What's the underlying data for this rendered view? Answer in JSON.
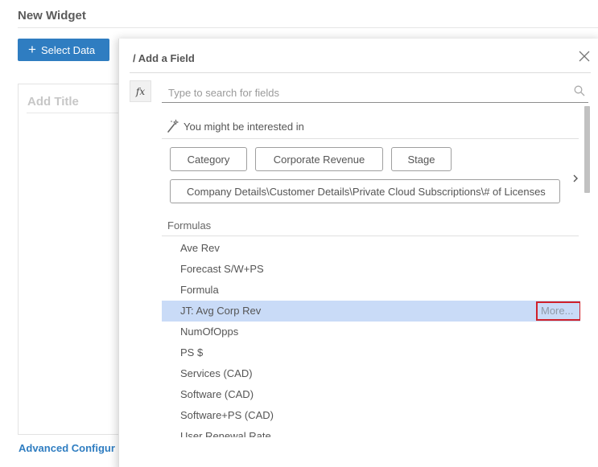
{
  "widget": {
    "title": "New Widget",
    "select_data_label": "Select Data",
    "add_title_placeholder": "Add Title",
    "advanced_config_label": "Advanced Configur"
  },
  "dialog": {
    "title": "/ Add a Field",
    "fx_label": "fx",
    "search_placeholder": "Type to search for fields",
    "suggestion_heading": "You might be interested in",
    "chips": [
      "Category",
      "Corporate Revenue",
      "Stage",
      "Company Details\\Customer Details\\Private Cloud Subscriptions\\# of Licenses"
    ],
    "section_heading": "Formulas",
    "items": [
      "Ave Rev",
      "Forecast S/W+PS",
      "Formula",
      "JT: Avg Corp Rev",
      "NumOfOpps",
      "PS $",
      "Services (CAD)",
      "Software (CAD)",
      "Software+PS (CAD)",
      "User Renewal Rate"
    ],
    "selected_index": 3,
    "more_label": "More..."
  },
  "colors": {
    "accent": "#2f7dc1",
    "selected_row": "#c9dbf7",
    "highlight_box": "#d0202a"
  }
}
